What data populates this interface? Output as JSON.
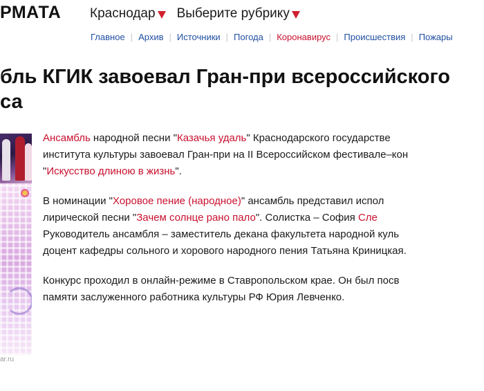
{
  "header": {
    "logo_text": "РМАТА",
    "region_menu": [
      {
        "label": "Краснодар"
      },
      {
        "label": "Выберите рубрику"
      }
    ],
    "nav": [
      {
        "label": "Главное",
        "highlight": false
      },
      {
        "label": "Архив",
        "highlight": false
      },
      {
        "label": "Источники",
        "highlight": false
      },
      {
        "label": "Погода",
        "highlight": false
      },
      {
        "label": "Коронавирус",
        "highlight": true
      },
      {
        "label": "Происшествия",
        "highlight": false
      },
      {
        "label": "Пожары",
        "highlight": false
      }
    ]
  },
  "article": {
    "title_line1": "бль КГИК завоевал Гран-при всероссийского",
    "title_line2": "са",
    "photo_credit": "ar.ru",
    "paragraphs": [
      {
        "lines": [
          [
            {
              "t": "Ансамбль",
              "red": true
            },
            {
              "t": " народной песни \"",
              "red": false
            },
            {
              "t": "Казачья удаль",
              "red": true
            },
            {
              "t": "\" Краснодарского государстве",
              "red": false
            }
          ],
          [
            {
              "t": "института культуры завоевал Гран-при на II Всероссийском фестивале–кон",
              "red": false
            }
          ],
          [
            {
              "t": "\"",
              "red": false
            },
            {
              "t": "Искусство длиною в жизнь",
              "red": true
            },
            {
              "t": "\".",
              "red": false
            }
          ]
        ]
      },
      {
        "lines": [
          [
            {
              "t": "В номинации \"",
              "red": false
            },
            {
              "t": "Хоровое пение (народное)",
              "red": true
            },
            {
              "t": "\" ансамбль представил испол",
              "red": false
            }
          ],
          [
            {
              "t": "лирической песни \"",
              "red": false
            },
            {
              "t": "Зачем солнце рано пало",
              "red": true
            },
            {
              "t": "\". Солистка – София ",
              "red": false
            },
            {
              "t": "Сле",
              "red": true
            }
          ],
          [
            {
              "t": "Руководитель ансамбля – заместитель декана факультета народной куль",
              "red": false
            }
          ],
          [
            {
              "t": "доцент кафедры сольного и хорового народного пения Татьяна Криницкая.",
              "red": false
            }
          ]
        ]
      },
      {
        "lines": [
          [
            {
              "t": "Конкурс проходил в онлайн-режиме в Ставропольском крае. Он был посв",
              "red": false
            }
          ],
          [
            {
              "t": "памяти заслуженного работника культуры РФ Юрия Левченко.",
              "red": false
            }
          ]
        ]
      }
    ]
  },
  "colors": {
    "accent_red": "#c8102e",
    "link_blue": "#1f4fa1",
    "region_arrow": "#d1202f"
  }
}
